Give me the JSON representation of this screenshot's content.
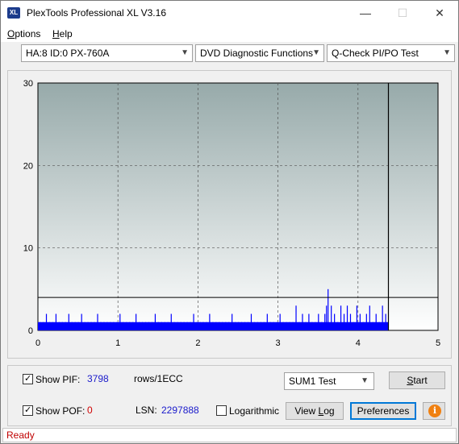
{
  "window": {
    "title": "PlexTools Professional XL V3.16",
    "icon_label": "XL",
    "minimize_glyph": "—",
    "maximize_glyph": "☐",
    "close_glyph": "✕"
  },
  "menu": {
    "options_first": "O",
    "options_rest": "ptions",
    "help_first": "H",
    "help_rest": "elp"
  },
  "toolbar": {
    "drive": "HA:8 ID:0  PX-760A",
    "function": "DVD Diagnostic Functions",
    "test": "Q-Check PI/PO Test"
  },
  "chart_data": {
    "type": "bar",
    "xlim": [
      0,
      5
    ],
    "ylim": [
      0,
      30
    ],
    "x_ticks": [
      "0",
      "1",
      "2",
      "3",
      "4",
      "5"
    ],
    "y_ticks": [
      "0",
      "10",
      "20",
      "30"
    ],
    "grid": true,
    "threshold_line": 4,
    "end_marker_x": 4.38,
    "series": [
      {
        "color": "#0000ff",
        "x": [
          0.02,
          0.06,
          0.1,
          0.14,
          0.18,
          0.22,
          0.26,
          0.3,
          0.34,
          0.38,
          0.42,
          0.46,
          0.5,
          0.54,
          0.58,
          0.62,
          0.66,
          0.7,
          0.74,
          0.78,
          0.82,
          0.86,
          0.9,
          0.94,
          0.98,
          1.02,
          1.06,
          1.1,
          1.14,
          1.18,
          1.22,
          1.26,
          1.3,
          1.34,
          1.38,
          1.42,
          1.46,
          1.5,
          1.54,
          1.58,
          1.62,
          1.66,
          1.7,
          1.74,
          1.78,
          1.82,
          1.86,
          1.9,
          1.94,
          1.98,
          2.02,
          2.06,
          2.1,
          2.14,
          2.18,
          2.22,
          2.26,
          2.3,
          2.34,
          2.38,
          2.42,
          2.46,
          2.5,
          2.54,
          2.58,
          2.62,
          2.66,
          2.7,
          2.74,
          2.78,
          2.82,
          2.86,
          2.9,
          2.94,
          2.98,
          3.02,
          3.06,
          3.1,
          3.14,
          3.18,
          3.22,
          3.26,
          3.3,
          3.34,
          3.38,
          3.42,
          3.46,
          3.5,
          3.54,
          3.58,
          3.6,
          3.62,
          3.66,
          3.7,
          3.74,
          3.78,
          3.82,
          3.86,
          3.9,
          3.94,
          3.98,
          4.02,
          4.06,
          4.1,
          4.14,
          4.18,
          4.22,
          4.26,
          4.3,
          4.34
        ],
        "values": [
          1,
          1,
          2,
          1,
          1,
          2,
          1,
          1,
          1,
          2,
          1,
          1,
          1,
          2,
          1,
          1,
          1,
          1,
          2,
          1,
          1,
          1,
          1,
          1,
          1,
          2,
          1,
          1,
          1,
          1,
          2,
          1,
          1,
          1,
          1,
          1,
          2,
          1,
          1,
          1,
          1,
          2,
          1,
          1,
          1,
          1,
          1,
          1,
          2,
          1,
          1,
          1,
          1,
          2,
          1,
          1,
          1,
          1,
          1,
          1,
          2,
          1,
          1,
          1,
          1,
          1,
          2,
          1,
          1,
          1,
          1,
          2,
          1,
          1,
          1,
          2,
          1,
          1,
          1,
          1,
          3,
          1,
          2,
          1,
          2,
          1,
          1,
          2,
          1,
          2,
          3,
          5,
          3,
          2,
          1,
          3,
          2,
          3,
          2,
          1,
          3,
          2,
          1,
          2,
          3,
          1,
          2,
          1,
          3,
          2
        ]
      }
    ]
  },
  "controls": {
    "show_pif_label": "Show PIF:",
    "pif_value": "3798",
    "rows_label": "rows/1ECC",
    "sum_select": "SUM1 Test",
    "start_first": "S",
    "start_rest": "tart",
    "show_pof_label": "Show POF:",
    "pof_value": "0",
    "lsn_label": "LSN:",
    "lsn_value": "2297888",
    "log_label": "Logarithmic",
    "view_first": "View ",
    "view_underlined": "L",
    "view_rest": "og",
    "preferences": "Preferences",
    "info_glyph": "i"
  },
  "status": {
    "text": "Ready"
  },
  "colors": {
    "bars": "#0000ff",
    "plot_top": "#97aaaa",
    "plot_bottom": "#ffffff",
    "status_text": "#c00000"
  }
}
